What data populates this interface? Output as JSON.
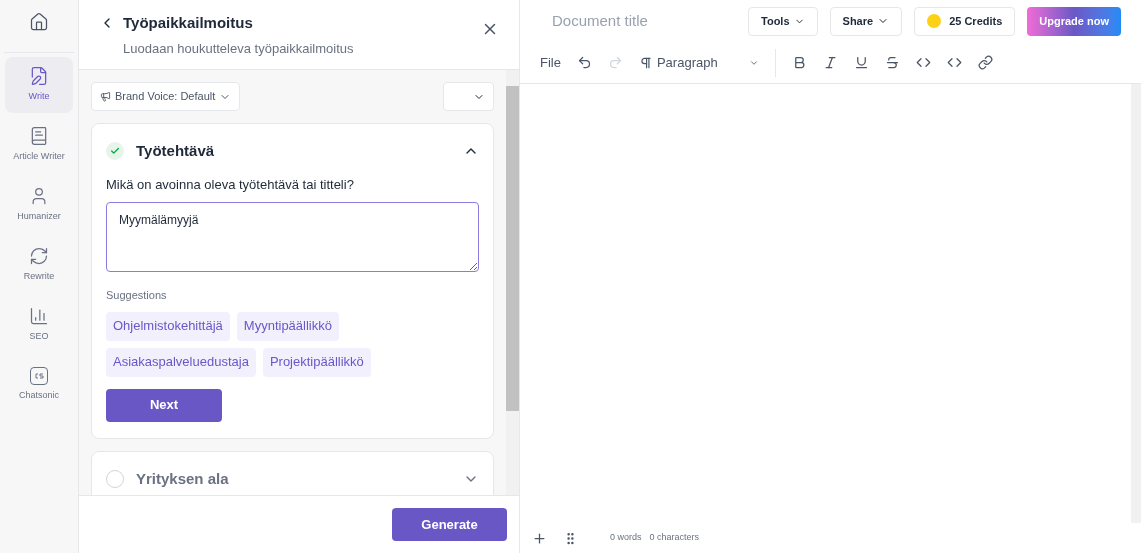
{
  "sidebar": {
    "items": [
      {
        "label": "Write",
        "selected": true
      },
      {
        "label": "Article Writer",
        "selected": false
      },
      {
        "label": "Humanizer",
        "selected": false
      },
      {
        "label": "Rewrite",
        "selected": false
      },
      {
        "label": "SEO",
        "selected": false
      },
      {
        "label": "Chatsonic",
        "selected": false
      }
    ]
  },
  "panel": {
    "title": "Työpaikkailmoitus",
    "subtitle": "Luodaan houkutteleva työpaikkailmoitus",
    "brand_voice": "Brand Voice: Default",
    "steps": [
      {
        "title": "Työtehtävä",
        "done": true,
        "expanded": true,
        "question": "Mikä on avoinna oleva työtehtävä tai titteli?",
        "value": "Myymälämyyjä",
        "suggestions_label": "Suggestions",
        "suggestions": [
          "Ohjelmistokehittäjä",
          "Myyntipäällikkö",
          "Asiakaspalveluedustaja",
          "Projektipäällikkö"
        ],
        "next": "Next"
      },
      {
        "title": "Yrityksen ala",
        "done": false,
        "expanded": false
      }
    ],
    "generate": "Generate"
  },
  "editor": {
    "title_placeholder": "Document title",
    "tools": "Tools",
    "share": "Share",
    "credits": "25 Credits",
    "upgrade": "Upgrade now",
    "file": "File",
    "paragraph": "Paragraph",
    "words": "0 words",
    "characters": "0 characters"
  }
}
